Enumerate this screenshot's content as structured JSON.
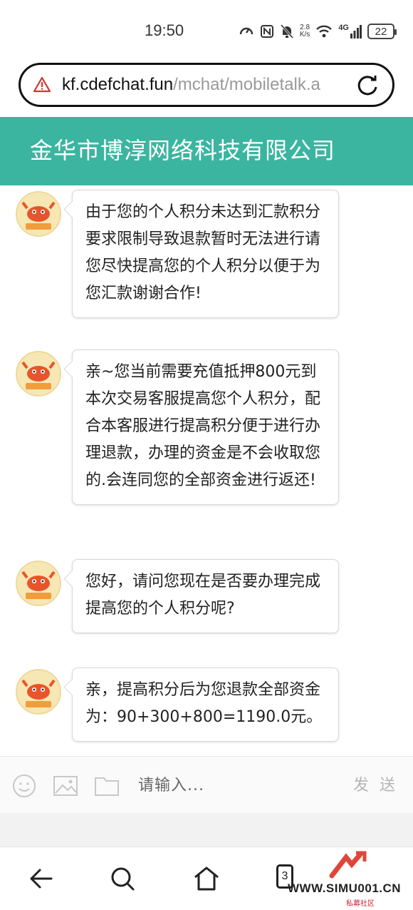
{
  "status_bar": {
    "time": "19:50",
    "net_speed_value": "2.8",
    "net_speed_unit": "K/s",
    "network": "4G",
    "battery": "22",
    "icons": [
      "speedometer-icon",
      "nfc-icon",
      "mute-bell-icon",
      "wifi-icon",
      "signal-icon",
      "battery-icon"
    ]
  },
  "browser": {
    "url_host": "kf.cdefchat.fun",
    "url_path": "/mchat/mobiletalk.a",
    "warning_icon": "warning-icon",
    "reload_icon": "reload-icon"
  },
  "chat": {
    "title": "金华市博淳网络科技有限公司",
    "header_color": "#3bb5a0",
    "messages": [
      {
        "text": "由于您的个人积分未达到汇款积分要求限制导致退款暂时无法进行请您尽快提高您的个人积分以便于为您汇款谢谢合作!"
      },
      {
        "text": "亲~您当前需要充值抵押800元到本次交易客服提高您个人积分，配合本客服进行提高积分便于进行办理退款，办理的资金是不会收取您的.会连同您的全部资金进行返还!"
      },
      {
        "text": "您好，请问您现在是否要办理完成提高您的个人积分呢?"
      },
      {
        "text": "亲，提高积分后为您退款全部资金为：90+300+800=1190.0元。"
      }
    ]
  },
  "input": {
    "placeholder": "请输入...",
    "send_label": "发 送",
    "tools": [
      "emoji-icon",
      "image-icon",
      "folder-icon"
    ]
  },
  "bottom_nav": {
    "tab_count": "3",
    "icons": [
      "back-arrow-icon",
      "search-icon",
      "home-icon",
      "tabs-icon"
    ]
  },
  "watermark": {
    "text": "WWW.SIMU001.CN",
    "sub": "私募社区"
  }
}
